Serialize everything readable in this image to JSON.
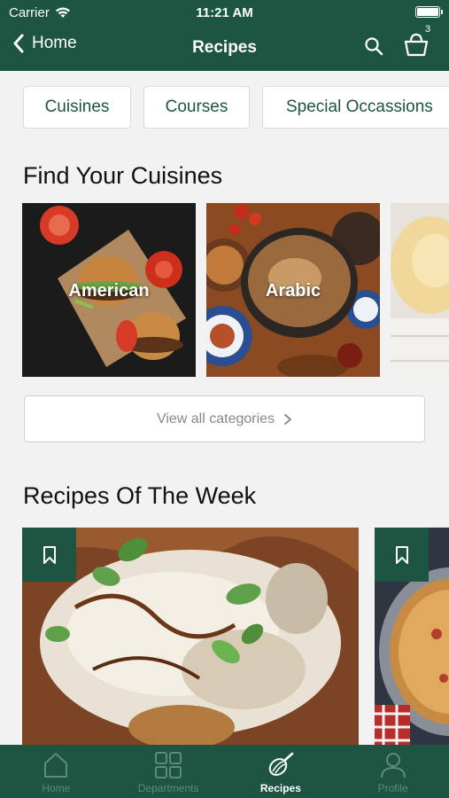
{
  "status": {
    "carrier": "Carrier",
    "time": "11:21 AM"
  },
  "nav": {
    "back_label": "Home",
    "title": "Recipes",
    "basket_count": "3"
  },
  "chips": [
    "Cuisines",
    "Courses",
    "Special Occassions"
  ],
  "cuisines_title": "Find Your Cuisines",
  "cuisines": [
    {
      "label": "American"
    },
    {
      "label": "Arabic"
    }
  ],
  "view_all": "View all categories",
  "week_title": "Recipes Of The Week",
  "tabs": [
    {
      "label": "Home",
      "icon": "home-icon"
    },
    {
      "label": "Departments",
      "icon": "grid-icon"
    },
    {
      "label": "Recipes",
      "icon": "whisk-icon"
    },
    {
      "label": "Profile",
      "icon": "profile-icon"
    }
  ],
  "colors": {
    "brand_green": "#1e5542",
    "tab_inactive": "#5f8a79"
  }
}
